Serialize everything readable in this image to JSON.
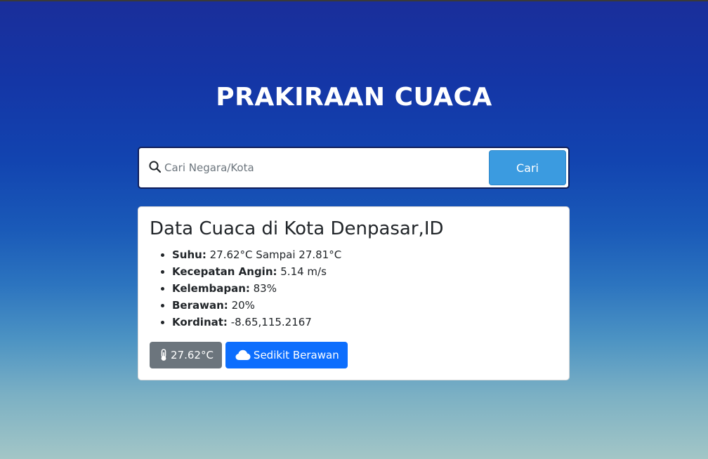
{
  "header": {
    "title": "PRAKIRAAN CUACA"
  },
  "search": {
    "placeholder": "Cari Negara/Kota",
    "value": "",
    "button_label": "Cari",
    "icon": "search-icon"
  },
  "weather_card": {
    "title": "Data Cuaca di Kota Denpasar,ID",
    "details": [
      {
        "label": "Suhu:",
        "value": " 27.62°C Sampai 27.81°C"
      },
      {
        "label": "Kecepatan Angin:",
        "value": " 5.14 m/s"
      },
      {
        "label": "Kelembapan:",
        "value": " 83%"
      },
      {
        "label": "Berawan:",
        "value": " 20%"
      },
      {
        "label": "Kordinat:",
        "value": " -8.65,115.2167"
      }
    ],
    "temperature_badge": {
      "icon": "thermometer-icon",
      "text": "27.62°C"
    },
    "condition_badge": {
      "icon": "cloud-icon",
      "text": "Sedikit Berawan"
    }
  },
  "colors": {
    "search_button": "#3b9be0",
    "temp_badge": "#6c757d",
    "condition_badge": "#0d6efd",
    "background_top": "#1a2e9a",
    "background_bottom": "#a3c6c6"
  }
}
